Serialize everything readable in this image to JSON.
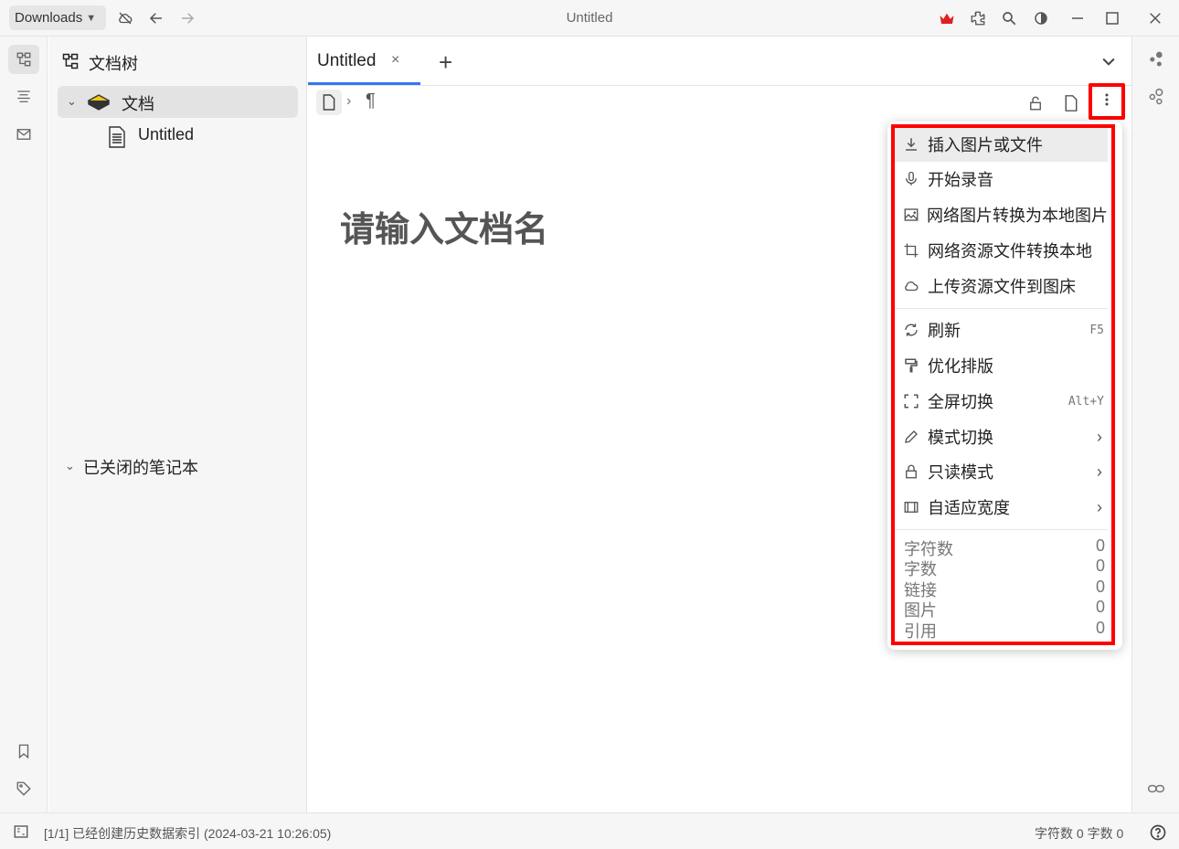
{
  "titlebar": {
    "workspace": "Downloads",
    "title": "Untitled"
  },
  "tree": {
    "title": "文档树",
    "notebook": "文档",
    "document": "Untitled",
    "closed_section": "已关闭的笔记本"
  },
  "tabs": [
    {
      "label": "Untitled",
      "close": "×"
    }
  ],
  "tab_add": "+",
  "breadcrumb": {
    "separator": "›",
    "para_symbol": "¶"
  },
  "editor": {
    "title_placeholder": "请输入文档名"
  },
  "menu": {
    "items": [
      {
        "label": "插入图片或文件",
        "icon": "download-icon"
      },
      {
        "label": "开始录音",
        "icon": "microphone-icon"
      },
      {
        "label": "网络图片转换为本地图片",
        "icon": "image-add-icon"
      },
      {
        "label": "网络资源文件转换本地",
        "icon": "crop-icon"
      },
      {
        "label": "上传资源文件到图床",
        "icon": "cloud-icon"
      },
      {
        "label": "刷新",
        "icon": "refresh-icon",
        "shortcut": "F5"
      },
      {
        "label": "优化排版",
        "icon": "format-paint-icon"
      },
      {
        "label": "全屏切换",
        "icon": "fullscreen-icon",
        "shortcut": "Alt+Y"
      },
      {
        "label": "模式切换",
        "icon": "edit-icon",
        "submenu": "›"
      },
      {
        "label": "只读模式",
        "icon": "lock-icon",
        "submenu": "›"
      },
      {
        "label": "自适应宽度",
        "icon": "width-icon",
        "submenu": "›"
      }
    ],
    "stats": [
      {
        "label": "字符数",
        "value": "0"
      },
      {
        "label": "字数",
        "value": "0"
      },
      {
        "label": "链接",
        "value": "0"
      },
      {
        "label": "图片",
        "value": "0"
      },
      {
        "label": "引用",
        "value": "0"
      }
    ]
  },
  "status": {
    "message": "[1/1] 已经创建历史数据索引 (2024-03-21 10:26:05)",
    "counts": "字符数 0  字数 0"
  },
  "colors": {
    "accent": "#3575f0",
    "highlight": "#ff0000"
  }
}
